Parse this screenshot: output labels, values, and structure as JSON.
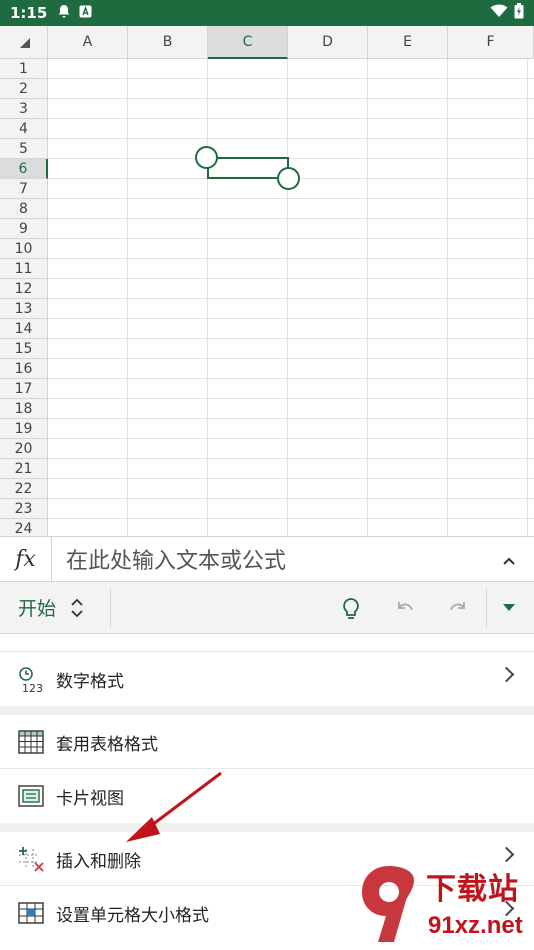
{
  "status_bar": {
    "time": "1:15"
  },
  "sheet": {
    "columns": [
      "A",
      "B",
      "C",
      "D",
      "E",
      "F"
    ],
    "selected_column": "C",
    "rows": [
      "1",
      "2",
      "3",
      "4",
      "5",
      "6",
      "7",
      "8",
      "9",
      "10",
      "11",
      "12",
      "13",
      "14",
      "15",
      "16",
      "17",
      "18",
      "19",
      "20",
      "21",
      "22",
      "23",
      "24"
    ],
    "selected_row": "6"
  },
  "formula_bar": {
    "fx": "fx",
    "placeholder": "在此处输入文本或公式"
  },
  "ribbon": {
    "tab": "开始"
  },
  "menu": {
    "number_format": "数字格式",
    "table_style": "套用表格格式",
    "card_view": "卡片视图",
    "insert_delete": "插入和删除",
    "cell_size": "设置单元格大小格式"
  },
  "watermark": {
    "line1": "下载站",
    "line2": "91xz.net"
  },
  "colors": {
    "accent": "#1e6b40",
    "status_bar": "#1e6b40",
    "watermark": "#c0141c"
  }
}
